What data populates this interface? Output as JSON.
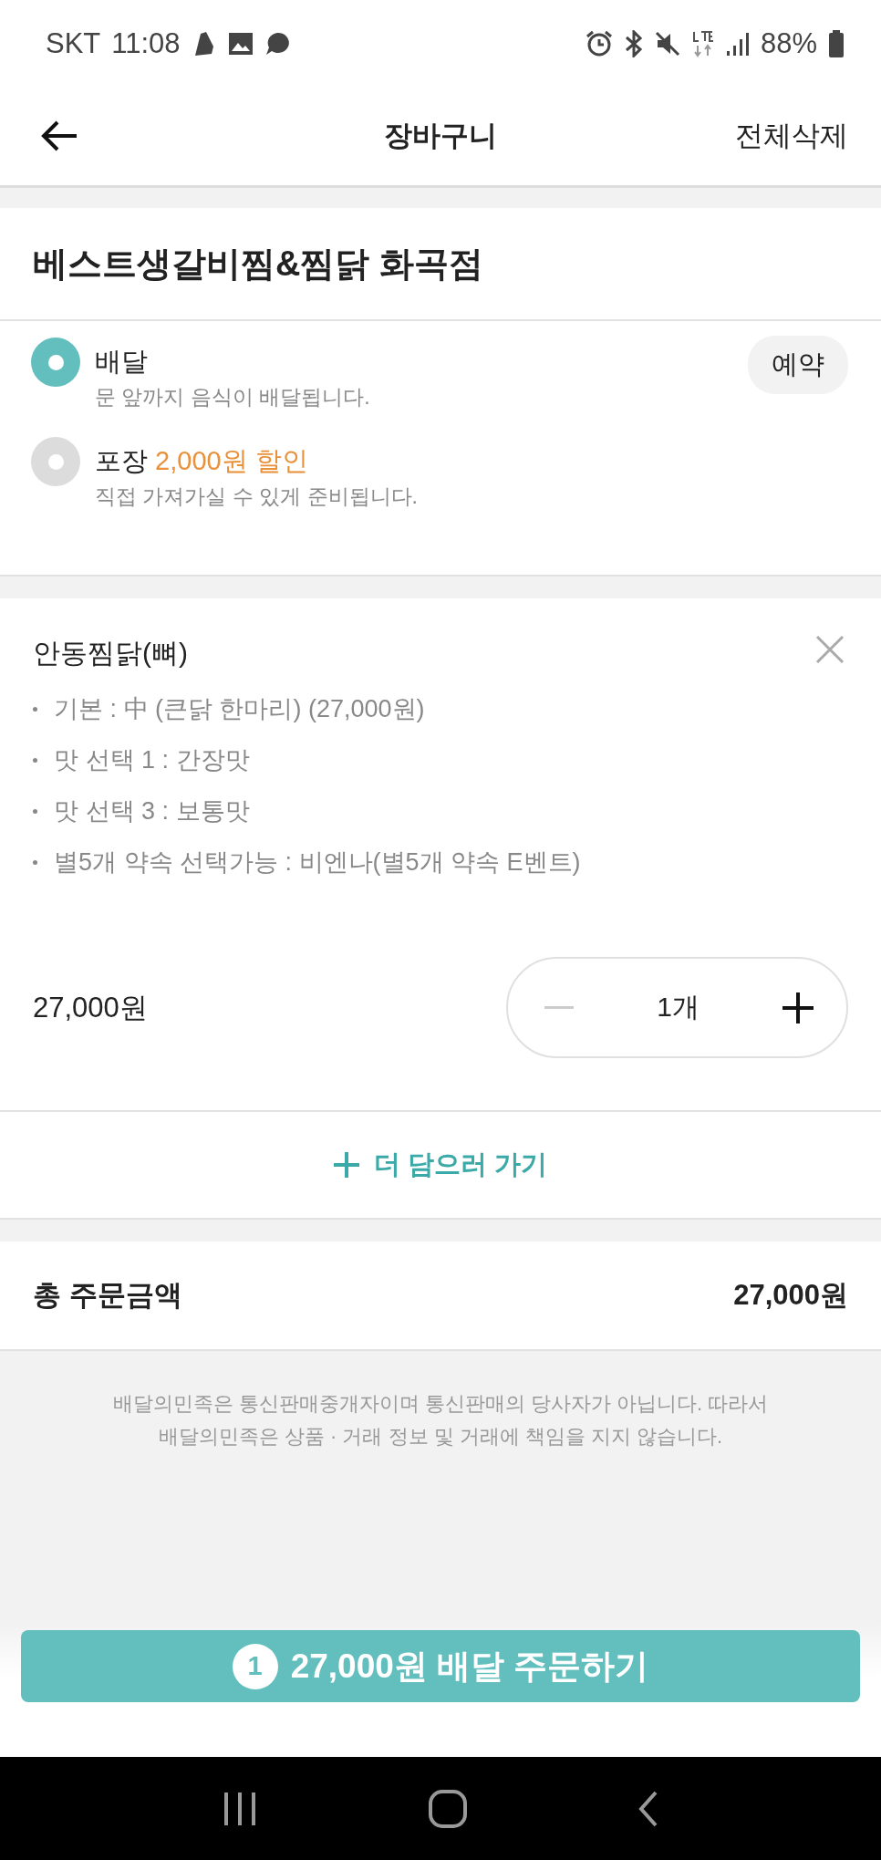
{
  "status_bar": {
    "carrier": "SKT",
    "time": "11:08",
    "battery": "88%"
  },
  "header": {
    "title": "장바구니",
    "action": "전체삭제"
  },
  "store": {
    "name": "베스트생갈비찜&찜닭 화곡점"
  },
  "order_types": [
    {
      "label": "배달",
      "description": "문 앞까지 음식이 배달됩니다.",
      "selected": true
    },
    {
      "label": "포장",
      "discount": "2,000원 할인",
      "description": "직접 가져가실 수 있게 준비됩니다.",
      "selected": false
    }
  ],
  "reserve_button": "예약",
  "cart_items": [
    {
      "name": "안동찜닭(뼈)",
      "options": [
        "기본 : 中 (큰닭 한마리) (27,000원)",
        "맛 선택 1 : 간장맛",
        "맛 선택 3 : 보통맛",
        "별5개 약속 선택가능 : 비엔나(별5개 약속 E벤트)"
      ],
      "price": "27,000원",
      "quantity": "1개",
      "decrease_disabled": true
    }
  ],
  "add_more": "더 담으러 가기",
  "total": {
    "label": "총 주문금액",
    "amount": "27,000원"
  },
  "disclaimer": "배달의민족은 통신판매중개자이며 통신판매의 당사자가 아닙니다. 따라서\n배달의민족은 상품 · 거래 정보 및 거래에 책임을 지지 않습니다.",
  "order_button": {
    "count": "1",
    "label": "27,000원 배달 주문하기"
  }
}
